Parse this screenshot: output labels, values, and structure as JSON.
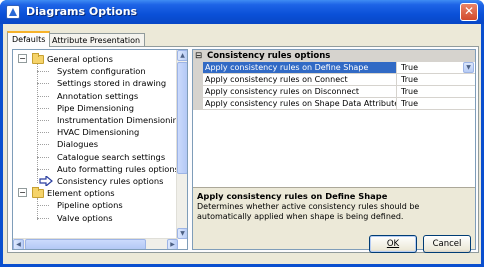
{
  "window": {
    "title": "Diagrams Options",
    "close_glyph": "✕"
  },
  "tabs": [
    {
      "label": "Defaults",
      "active": true
    },
    {
      "label": "Attribute Presentation",
      "active": false
    }
  ],
  "tree": {
    "groups": [
      {
        "label": "General options",
        "expander": "−",
        "items": [
          "System configuration",
          "Settings stored in drawing",
          "Annotation settings",
          "Pipe Dimensioning",
          "Instrumentation Dimensioning",
          "HVAC Dimensioning",
          "Dialogues",
          "Catalogue search settings",
          "Auto formatting rules options",
          "Consistency rules options"
        ]
      },
      {
        "label": "Element options",
        "expander": "−",
        "items": [
          "Pipeline options",
          "Valve options"
        ]
      }
    ],
    "selected_item": "Consistency rules options"
  },
  "grid": {
    "category": "Consistency rules options",
    "category_expander": "⊟",
    "rows": [
      {
        "name": "Apply consistency rules on Define Shape",
        "value": "True",
        "selected": true
      },
      {
        "name": "Apply consistency rules on Connect",
        "value": "True",
        "selected": false
      },
      {
        "name": "Apply consistency rules on Disconnect",
        "value": "True",
        "selected": false
      },
      {
        "name": "Apply consistency rules on Shape Data Attribute Char",
        "value": "True",
        "selected": false
      }
    ],
    "help": {
      "title": "Apply consistency rules on Define Shape",
      "description": "Determines whether active consistency rules should be automatically applied when shape is being defined."
    }
  },
  "buttons": {
    "ok": "OK",
    "cancel": "Cancel"
  }
}
